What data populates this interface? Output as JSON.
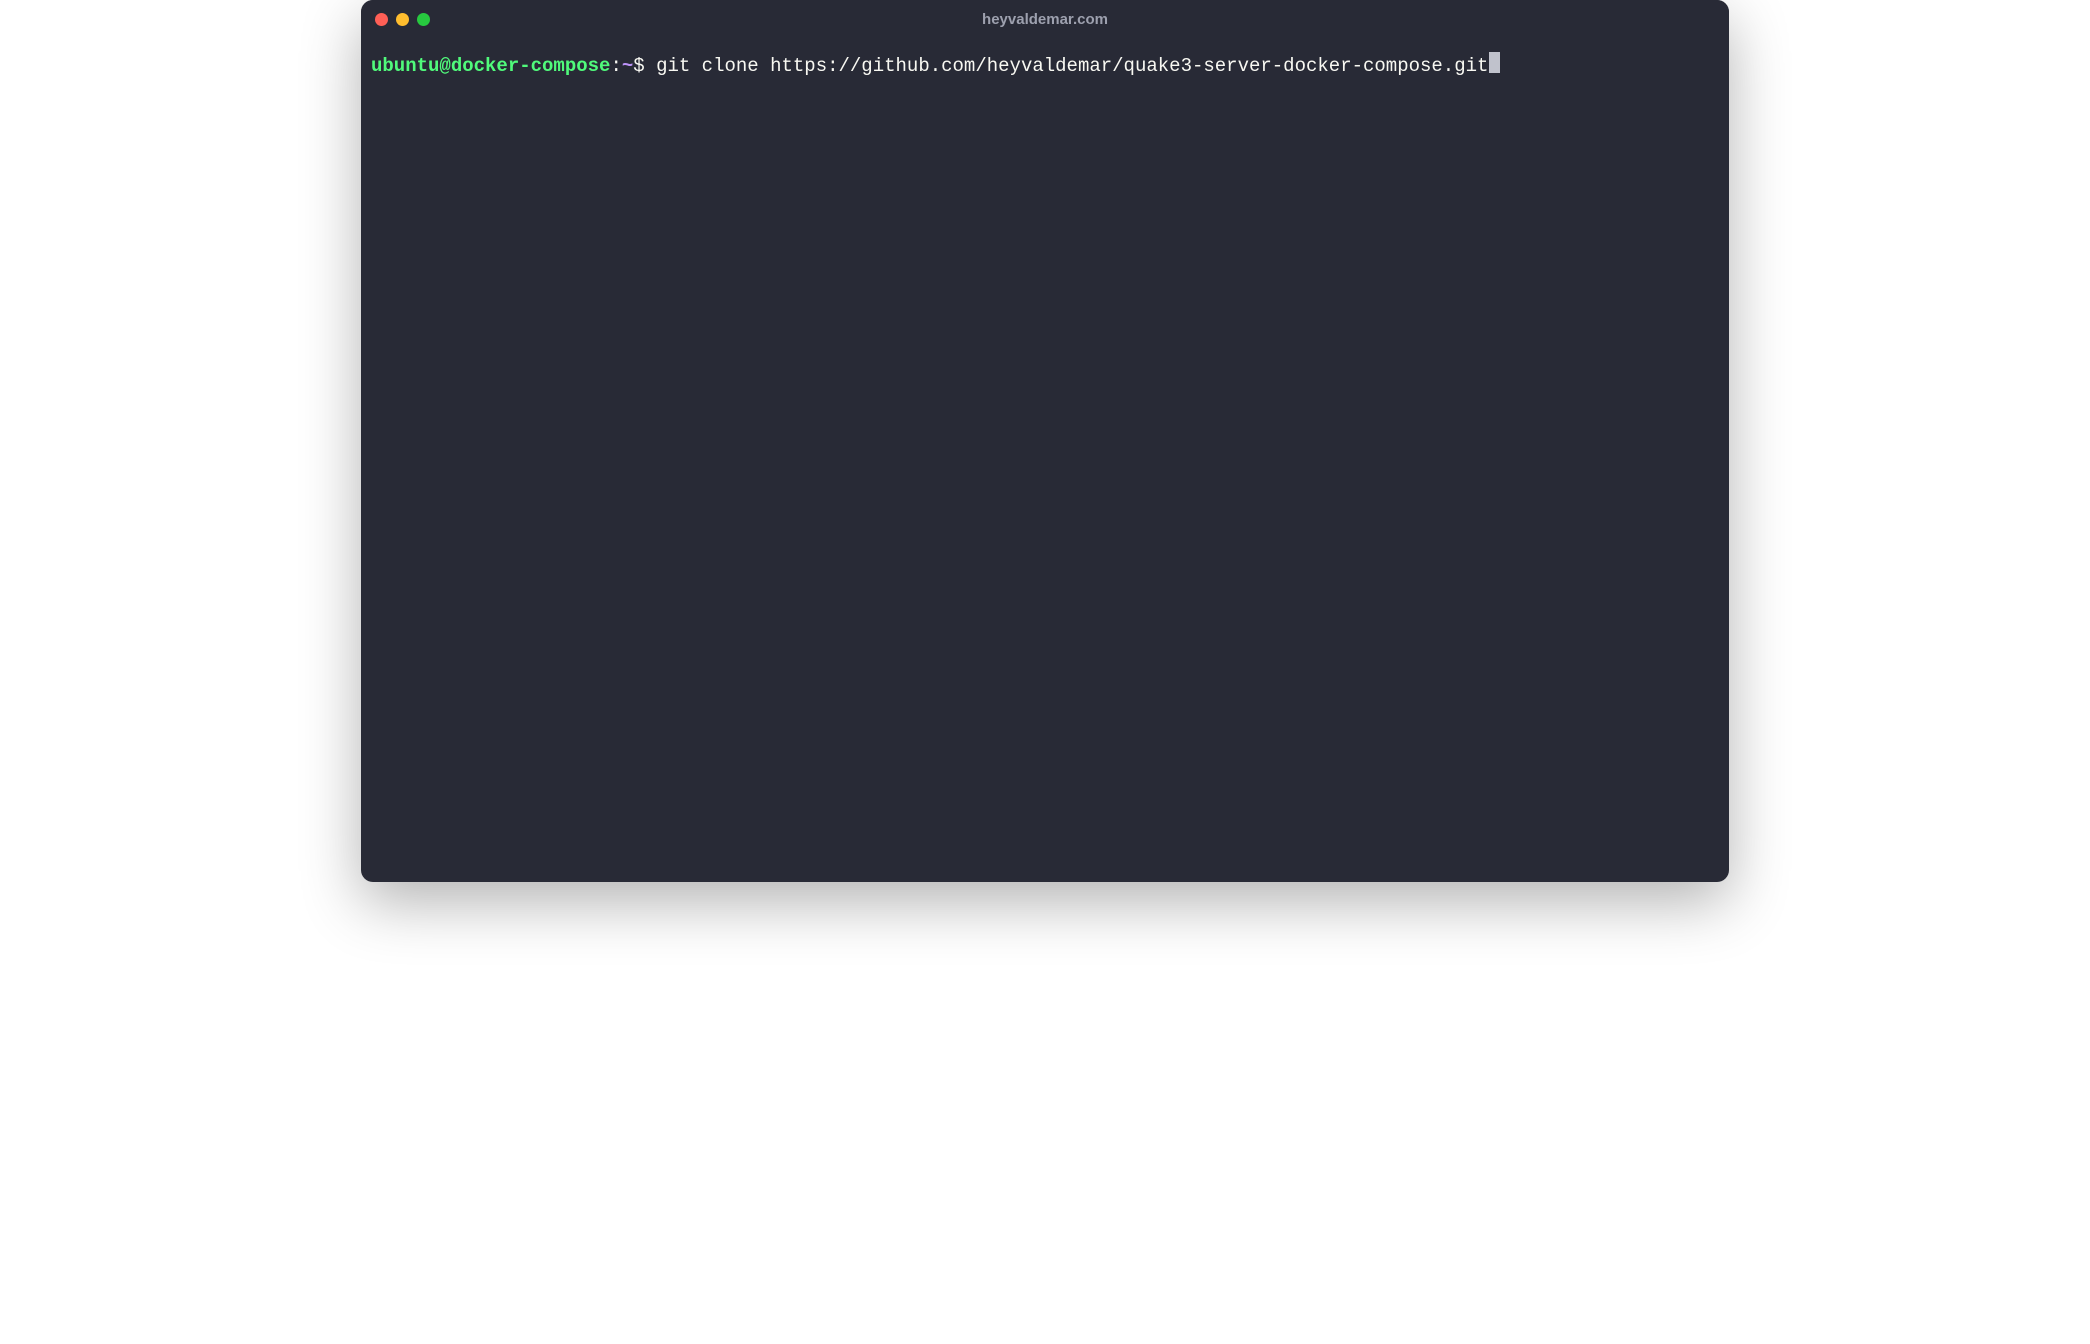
{
  "window": {
    "title": "heyvaldemar.com"
  },
  "prompt": {
    "user_host": "ubuntu@docker-compose",
    "separator": ":",
    "path": "~",
    "symbol": "$ "
  },
  "command": "git clone https://github.com/heyvaldemar/quake3-server-docker-compose.git",
  "colors": {
    "background": "#282a36",
    "foreground": "#f8f8f2",
    "user_host": "#50fa7b",
    "path": "#bd93f9",
    "title": "#9da0ae",
    "cursor": "#c0c2cc",
    "traffic_red": "#ff5f56",
    "traffic_yellow": "#ffbd2e",
    "traffic_green": "#27c93f"
  }
}
